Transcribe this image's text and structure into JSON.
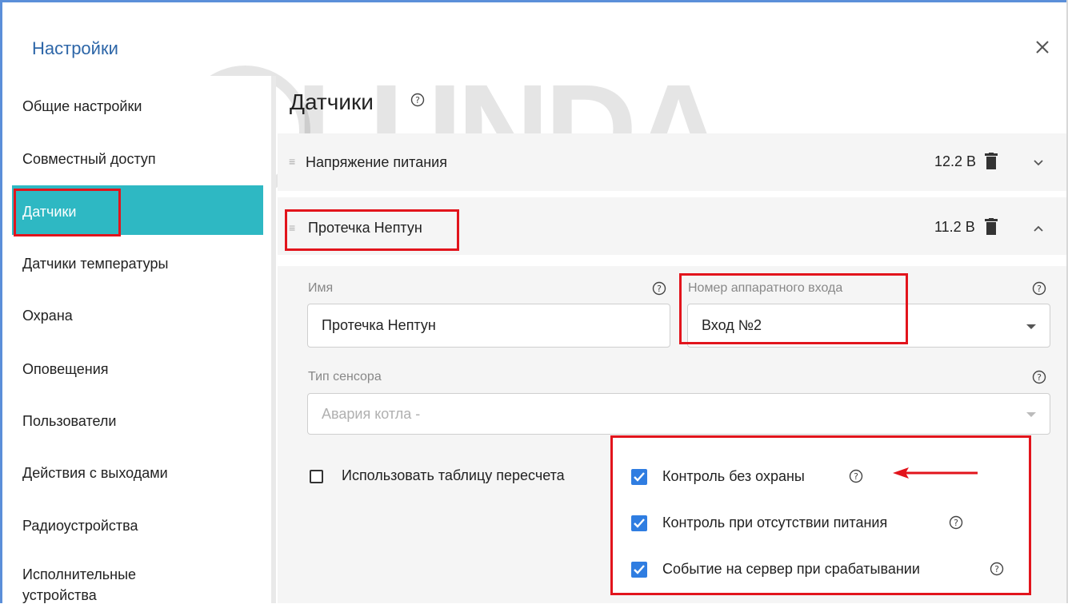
{
  "dialog": {
    "title": "Настройки"
  },
  "sidebar": {
    "items": [
      {
        "label": "Общие настройки"
      },
      {
        "label": "Совместный доступ"
      },
      {
        "label": "Датчики"
      },
      {
        "label": "Датчики температуры"
      },
      {
        "label": "Охрана"
      },
      {
        "label": "Оповещения"
      },
      {
        "label": "Пользователи"
      },
      {
        "label": "Действия с выходами"
      },
      {
        "label": "Радиоустройства"
      },
      {
        "label": "Исполнительные"
      },
      {
        "label": "устройства"
      }
    ],
    "active_index": 2
  },
  "watermark": {
    "text": "LUNDA"
  },
  "main": {
    "title": "Датчики",
    "sensors": [
      {
        "name": "Напряжение питания",
        "value": "12.2 В",
        "expanded": false
      },
      {
        "name": "Протечка Нептун",
        "value": "11.2 В",
        "expanded": true
      }
    ],
    "form": {
      "name_label": "Имя",
      "name_value": "Протечка Нептун",
      "input_label": "Номер аппаратного входа",
      "input_value": "Вход №2",
      "sensor_type_label": "Тип сенсора",
      "sensor_type_placeholder": "Авария котла -",
      "use_table_label": "Использовать таблицу пересчета"
    },
    "options": [
      {
        "label": "Контроль без охраны",
        "checked": true
      },
      {
        "label": "Контроль при отсутствии питания",
        "checked": true
      },
      {
        "label": "Событие на сервер при срабатывании",
        "checked": true
      }
    ]
  },
  "colors": {
    "accent": "#2eb8c3",
    "checkbox": "#2f7de1",
    "highlight": "#e2141c",
    "title": "#2d66a8"
  }
}
